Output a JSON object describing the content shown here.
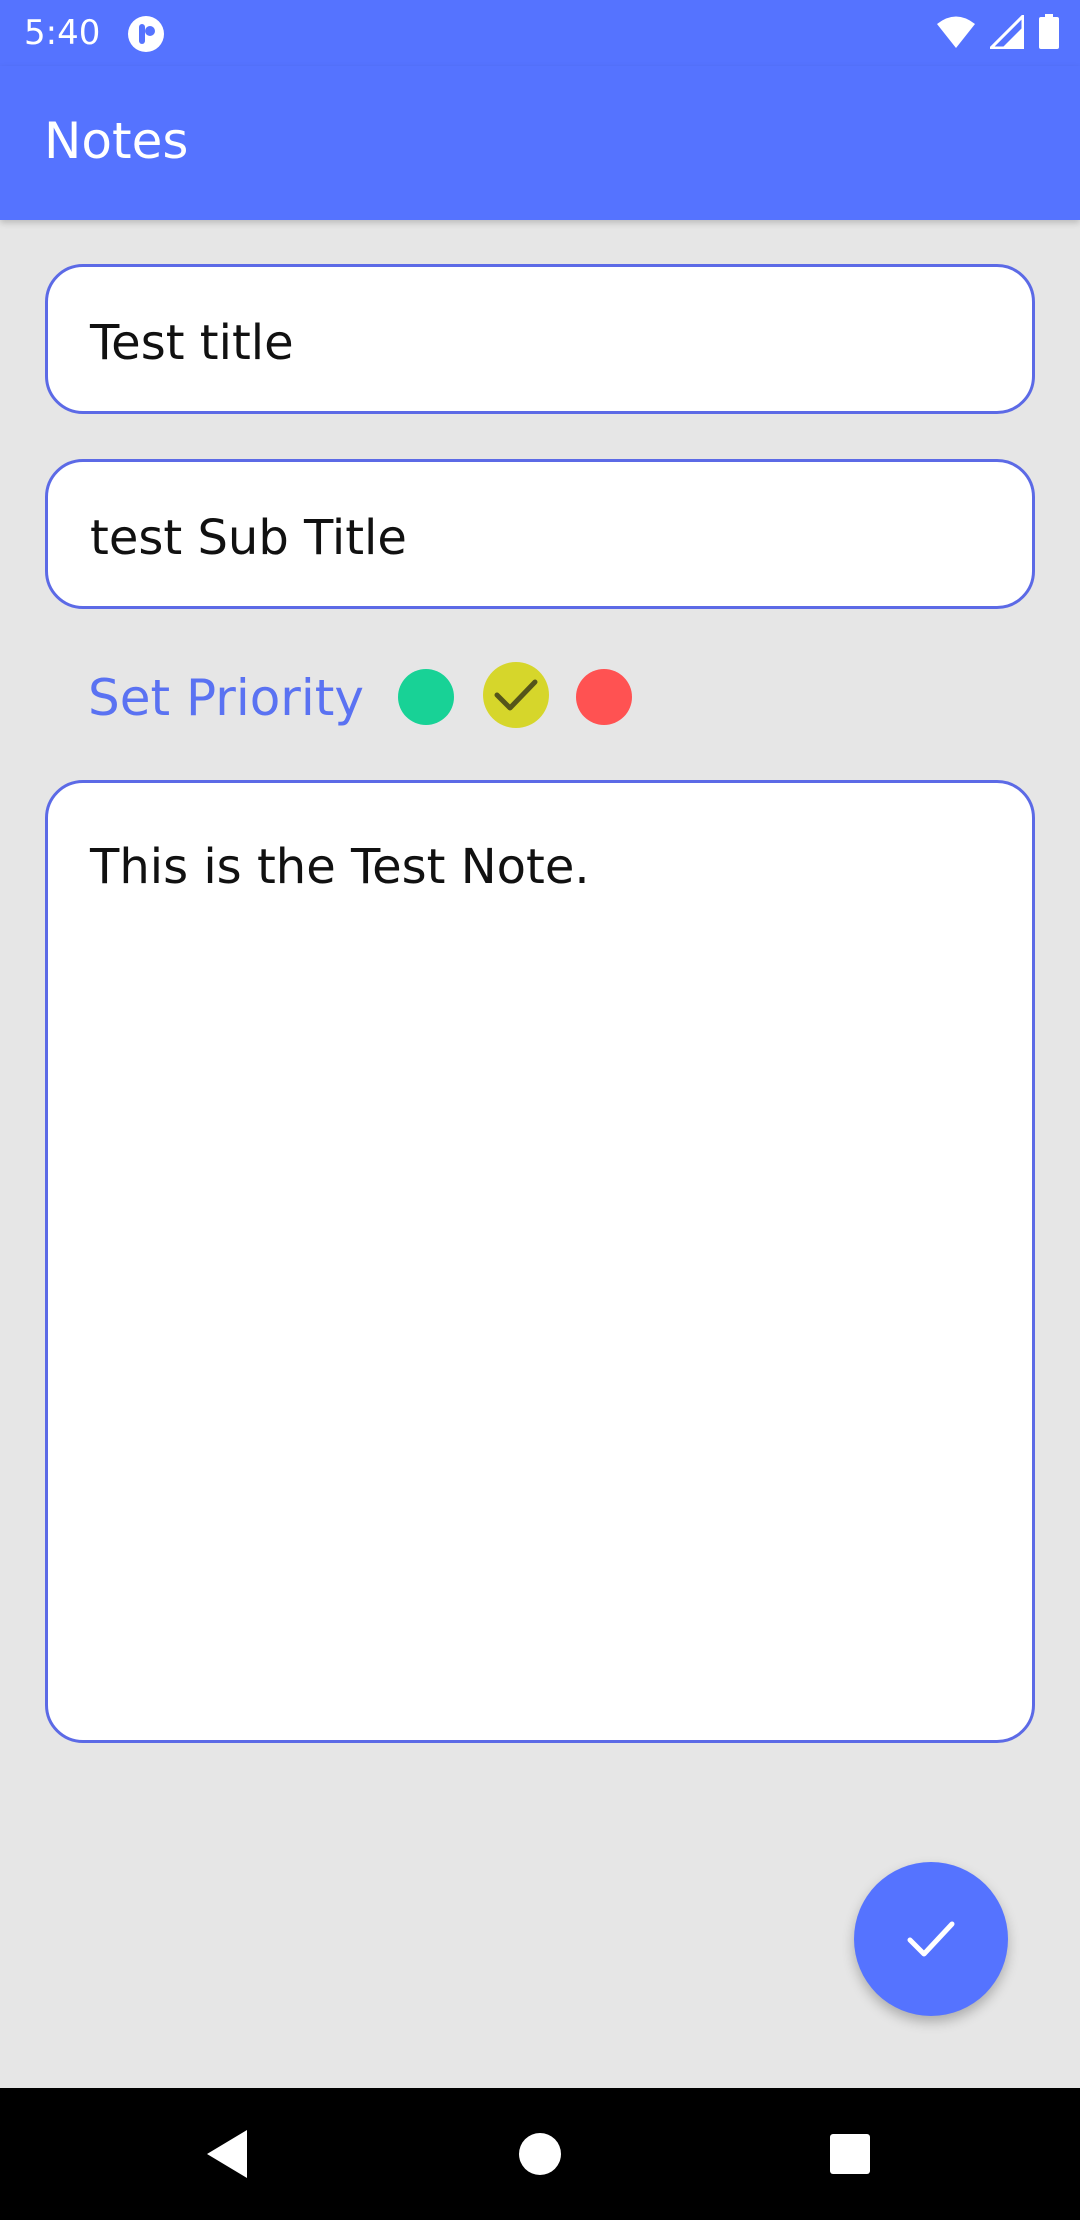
{
  "status_bar": {
    "time": "5:40",
    "icons": [
      "app-notification-icon",
      "wifi-icon",
      "signal-icon",
      "battery-icon"
    ]
  },
  "app_bar": {
    "title": "Notes"
  },
  "form": {
    "title_value": "Test title",
    "subtitle_value": "test Sub Title",
    "note_value": "This is the Test Note."
  },
  "priority": {
    "label": "Set Priority",
    "options": [
      {
        "name": "green",
        "color": "#18d296"
      },
      {
        "name": "yellow",
        "color": "#d6d62b",
        "selected": true
      },
      {
        "name": "red",
        "color": "#ff5252"
      }
    ]
  },
  "fab": {
    "icon": "check-icon"
  },
  "nav_bar": {
    "icons": [
      "back-icon",
      "home-icon",
      "recents-icon"
    ]
  },
  "colors": {
    "primary": "#5573ff",
    "background": "#e6e6e6",
    "field_border": "#5c6ae6",
    "label": "#5a72f2"
  }
}
